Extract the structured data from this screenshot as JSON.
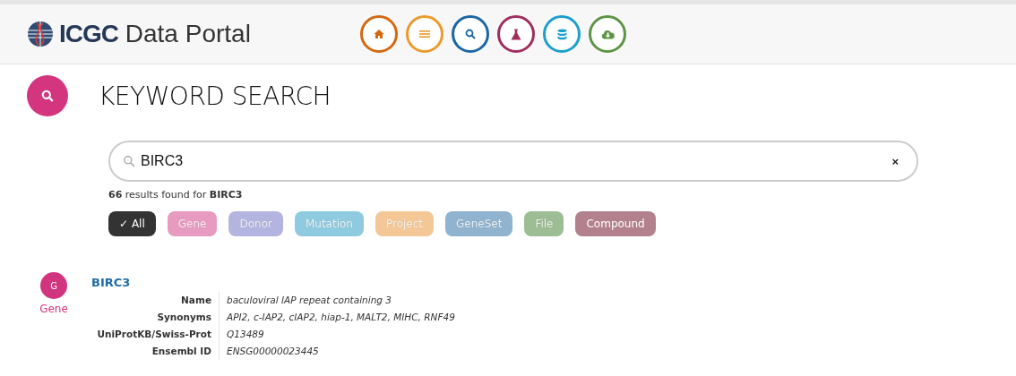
{
  "header": {
    "logo": {
      "bold": "ICGC",
      "text": "Data Portal"
    },
    "nav": [
      {
        "kind": "home",
        "color": "#d4690f"
      },
      {
        "kind": "list",
        "color": "#eb9a2b"
      },
      {
        "kind": "search",
        "color": "#1b67a5"
      },
      {
        "kind": "flask",
        "color": "#9f2e5e"
      },
      {
        "kind": "database",
        "color": "#1b9fcb"
      },
      {
        "kind": "cloud",
        "color": "#5e9446"
      }
    ]
  },
  "page": {
    "title": "KEYWORD SEARCH"
  },
  "search": {
    "value": "BIRC3",
    "clear": "×"
  },
  "summary": "**66** results found for **BIRC3**",
  "filters": [
    {
      "label": "All",
      "check": "✓",
      "selected": true,
      "disabled": false,
      "color": "#333333"
    },
    {
      "label": "Gene",
      "selected": false,
      "disabled": true,
      "color": "#e89bc0"
    },
    {
      "label": "Donor",
      "selected": false,
      "disabled": true,
      "color": "#b4b4e0"
    },
    {
      "label": "Mutation",
      "selected": false,
      "disabled": true,
      "color": "#8fcbe0"
    },
    {
      "label": "Project",
      "selected": false,
      "disabled": true,
      "color": "#f4c896"
    },
    {
      "label": "GeneSet",
      "selected": false,
      "disabled": true,
      "color": "#90b4cf"
    },
    {
      "label": "File",
      "selected": false,
      "disabled": true,
      "color": "#9dbd95"
    },
    {
      "label": "Compound",
      "selected": false,
      "disabled": false,
      "color": "#b3808e"
    }
  ],
  "results": [
    {
      "badge": "G",
      "type": "Gene",
      "color": "#d1357f",
      "title": "BIRC3",
      "fields": [
        {
          "label": "Name",
          "value": "baculoviral IAP repeat containing 3"
        },
        {
          "label": "Synonyms",
          "value": "API2, c-IAP2, cIAP2, hiap-1, MALT2, MIHC, RNF49"
        },
        {
          "label": "UniProtKB/Swiss-Prot",
          "value": "Q13489"
        },
        {
          "label": "Ensembl ID",
          "value": "ENSG00000023445"
        }
      ]
    }
  ]
}
